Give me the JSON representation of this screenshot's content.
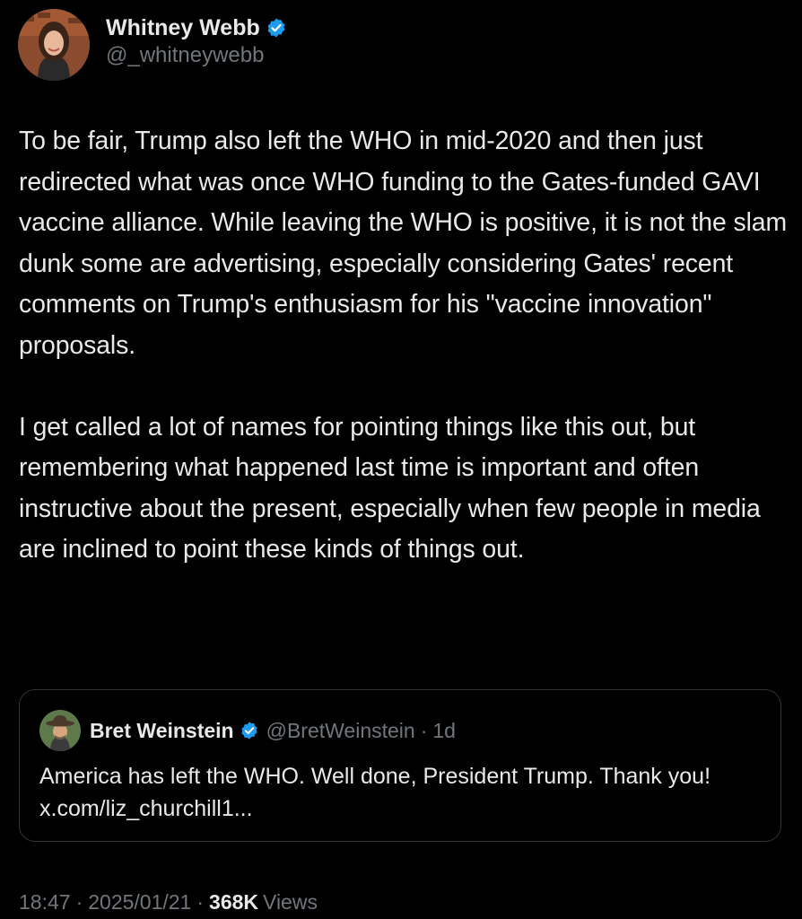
{
  "author": {
    "display_name": "Whitney Webb",
    "handle": "@_whitneywebb",
    "verified": true,
    "avatar_icon": "profile-photo-woman"
  },
  "tweet": {
    "text": "To be fair, Trump also left the WHO in mid-2020 and then just redirected what was once WHO funding to the Gates-funded GAVI vaccine alliance. While leaving the WHO is positive, it is not the slam dunk some are advertising, especially considering Gates' recent comments on Trump's enthusiasm for his \"vaccine innovation\" proposals.\n\nI get called a lot of names for pointing things like this out, but remembering what happened last time is important and often instructive about the present, especially when few people in media are inclined to point these kinds of things out."
  },
  "quote": {
    "display_name": "Bret Weinstein",
    "handle": "@BretWeinstein",
    "separator": "·",
    "time": "1d",
    "verified": true,
    "avatar_icon": "profile-photo-man-hat",
    "text": "America has left the WHO. Well done, President Trump. Thank you! x.com/liz_churchill1..."
  },
  "meta": {
    "time": "18:47",
    "separator": "·",
    "date": "2025/01/21",
    "views_count": "368K",
    "views_label": "Views"
  },
  "colors": {
    "background": "#000000",
    "primary_text": "#e7e9ea",
    "secondary_text": "#71767b",
    "verified_blue": "#1d9bf0",
    "card_border": "#2f3336"
  }
}
